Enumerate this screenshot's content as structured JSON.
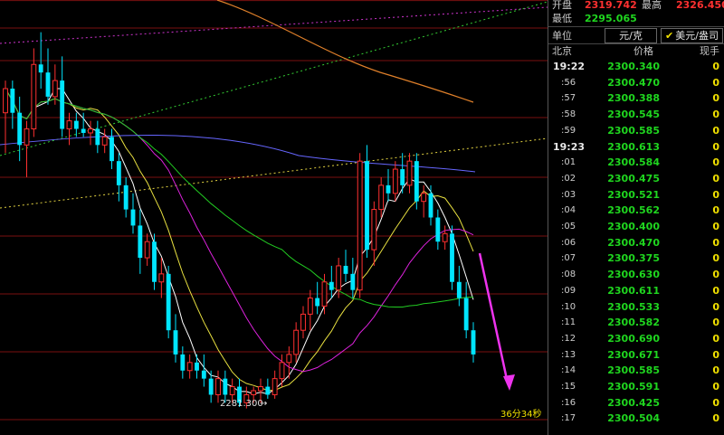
{
  "quote": {
    "open_label": "开盘",
    "open_value": "2319.742",
    "high_label": "最高",
    "high_value": "2326.450",
    "low_label": "最低",
    "low_value": "2295.065"
  },
  "unit_row": {
    "label": "单位",
    "unit": "元/克",
    "alt_unit": "美元/盎司"
  },
  "table_header": {
    "time": "北京",
    "price": "价格",
    "volume": "现手"
  },
  "ticks": [
    {
      "time": "19:22",
      "price": "2300.340",
      "vol": "0"
    },
    {
      "time": ":56",
      "price": "2300.470",
      "vol": "0"
    },
    {
      "time": ":57",
      "price": "2300.388",
      "vol": "0"
    },
    {
      "time": ":58",
      "price": "2300.545",
      "vol": "0"
    },
    {
      "time": ":59",
      "price": "2300.585",
      "vol": "0"
    },
    {
      "time": "19:23",
      "price": "2300.613",
      "vol": "0"
    },
    {
      "time": ":01",
      "price": "2300.584",
      "vol": "0"
    },
    {
      "time": ":02",
      "price": "2300.475",
      "vol": "0"
    },
    {
      "time": ":03",
      "price": "2300.521",
      "vol": "0"
    },
    {
      "time": ":04",
      "price": "2300.562",
      "vol": "0"
    },
    {
      "time": ":05",
      "price": "2300.400",
      "vol": "0"
    },
    {
      "time": ":06",
      "price": "2300.470",
      "vol": "0"
    },
    {
      "time": ":07",
      "price": "2300.375",
      "vol": "0"
    },
    {
      "time": ":08",
      "price": "2300.630",
      "vol": "0"
    },
    {
      "time": ":09",
      "price": "2300.611",
      "vol": "0"
    },
    {
      "time": ":10",
      "price": "2300.533",
      "vol": "0"
    },
    {
      "time": ":11",
      "price": "2300.582",
      "vol": "0"
    },
    {
      "time": ":12",
      "price": "2300.690",
      "vol": "0"
    },
    {
      "time": ":13",
      "price": "2300.671",
      "vol": "0"
    },
    {
      "time": ":14",
      "price": "2300.585",
      "vol": "0"
    },
    {
      "time": ":15",
      "price": "2300.591",
      "vol": "0"
    },
    {
      "time": ":16",
      "price": "2300.425",
      "vol": "0"
    },
    {
      "time": ":17",
      "price": "2300.504",
      "vol": "0"
    }
  ],
  "chart_data": {
    "type": "candlestick",
    "low_label": "2281.300",
    "countdown": "36分34秒",
    "up_color": "#ff3030",
    "down_color": "#00e5ff",
    "ylim": [
      2278,
      2332
    ],
    "candles": [
      [
        2318,
        2322,
        2313,
        2321
      ],
      [
        2321,
        2322,
        2316,
        2318
      ],
      [
        2318,
        2320,
        2312,
        2314
      ],
      [
        2314,
        2317,
        2310,
        2316
      ],
      [
        2316,
        2326,
        2315,
        2324
      ],
      [
        2324,
        2328,
        2321,
        2323
      ],
      [
        2323,
        2326,
        2319,
        2320
      ],
      [
        2320,
        2324,
        2319,
        2322
      ],
      [
        2322,
        2325,
        2315,
        2316
      ],
      [
        2316,
        2318,
        2314,
        2317
      ],
      [
        2317,
        2318,
        2315,
        2316
      ],
      [
        2316,
        2318,
        2315,
        2315.5
      ],
      [
        2315.5,
        2317,
        2314,
        2316
      ],
      [
        2316,
        2317,
        2313,
        2314
      ],
      [
        2314,
        2316,
        2313,
        2315
      ],
      [
        2315,
        2316,
        2311,
        2312
      ],
      [
        2312,
        2313,
        2307,
        2309
      ],
      [
        2309,
        2310,
        2305,
        2306
      ],
      [
        2306,
        2308,
        2303,
        2304
      ],
      [
        2304,
        2306,
        2298,
        2300
      ],
      [
        2300,
        2303,
        2299,
        2302
      ],
      [
        2302,
        2303,
        2296,
        2297
      ],
      [
        2297,
        2300,
        2295,
        2298
      ],
      [
        2298,
        2299,
        2290,
        2291
      ],
      [
        2291,
        2293,
        2287,
        2288
      ],
      [
        2288,
        2289,
        2285,
        2286
      ],
      [
        2286,
        2288,
        2285,
        2287
      ],
      [
        2287,
        2288,
        2285,
        2286
      ],
      [
        2286,
        2288,
        2284,
        2285
      ],
      [
        2285,
        2286,
        2282,
        2283
      ],
      [
        2283,
        2286,
        2282,
        2285
      ],
      [
        2285,
        2286,
        2282,
        2283
      ],
      [
        2283,
        2285,
        2282,
        2284
      ],
      [
        2284,
        2285,
        2281.5,
        2282
      ],
      [
        2282,
        2284,
        2281.3,
        2283
      ],
      [
        2283,
        2284,
        2282,
        2283.5
      ],
      [
        2283.5,
        2285,
        2282,
        2284
      ],
      [
        2284,
        2285,
        2282.5,
        2283
      ],
      [
        2283,
        2286,
        2282.5,
        2285
      ],
      [
        2285,
        2288,
        2284,
        2287
      ],
      [
        2287,
        2289,
        2285,
        2288
      ],
      [
        2288,
        2292,
        2287,
        2291
      ],
      [
        2291,
        2294,
        2290,
        2293
      ],
      [
        2293,
        2296,
        2291,
        2295
      ],
      [
        2295,
        2297,
        2293,
        2294
      ],
      [
        2294,
        2298,
        2293,
        2297
      ],
      [
        2297,
        2299,
        2295,
        2296
      ],
      [
        2296,
        2300,
        2295,
        2299
      ],
      [
        2299,
        2301,
        2297,
        2298
      ],
      [
        2298,
        2300,
        2295,
        2296
      ],
      [
        2296,
        2313,
        2295,
        2312
      ],
      [
        2312,
        2314,
        2300,
        2301
      ],
      [
        2301,
        2307,
        2299,
        2306
      ],
      [
        2306,
        2310,
        2305,
        2309
      ],
      [
        2309,
        2311,
        2307,
        2308
      ],
      [
        2308,
        2312,
        2307,
        2311
      ],
      [
        2311,
        2313,
        2308,
        2309
      ],
      [
        2309,
        2313,
        2308,
        2312
      ],
      [
        2312,
        2313,
        2306,
        2307
      ],
      [
        2307,
        2309,
        2305,
        2308
      ],
      [
        2308,
        2309,
        2304,
        2305
      ],
      [
        2305,
        2306,
        2301,
        2302
      ],
      [
        2302,
        2304,
        2301,
        2303
      ],
      [
        2303,
        2304,
        2296,
        2297
      ],
      [
        2297,
        2299,
        2294,
        2295
      ],
      [
        2295,
        2297,
        2290,
        2291
      ],
      [
        2291,
        2292,
        2287,
        2288
      ]
    ]
  }
}
